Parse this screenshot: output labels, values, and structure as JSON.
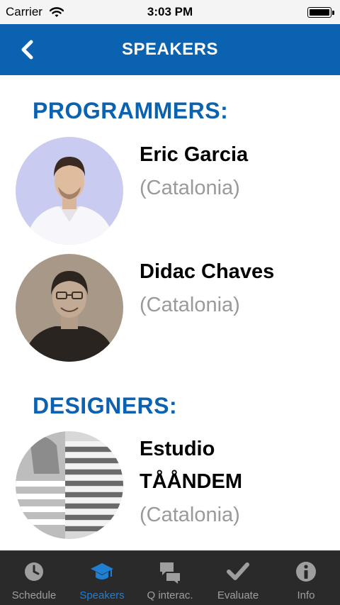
{
  "status_bar": {
    "carrier": "Carrier",
    "time": "3:03 PM"
  },
  "nav": {
    "title": "SPEAKERS",
    "back_icon": "chevron-left-icon"
  },
  "sections": [
    {
      "title": "PROGRAMMERS:",
      "speakers": [
        {
          "name_lines": [
            "Eric Garcia"
          ],
          "region": "(Catalonia)"
        },
        {
          "name_lines": [
            "Didac Chaves"
          ],
          "region": "(Catalonia)"
        }
      ]
    },
    {
      "title": "DESIGNERS:",
      "speakers": [
        {
          "name_lines": [
            "Estudio",
            "TÅÅNDEM"
          ],
          "region": "(Catalonia)"
        }
      ]
    }
  ],
  "tabs": [
    {
      "label": "Schedule",
      "icon": "clock-icon",
      "active": false
    },
    {
      "label": "Speakers",
      "icon": "graduation-cap-icon",
      "active": true
    },
    {
      "label": "Q interac.",
      "icon": "chat-bubbles-icon",
      "active": false
    },
    {
      "label": "Evaluate",
      "icon": "checkmark-icon",
      "active": false
    },
    {
      "label": "Info",
      "icon": "info-icon",
      "active": false
    }
  ],
  "colors": {
    "accent": "#0b62b0",
    "tab_active": "#1f7fd2",
    "tab_inactive": "#9e9e9e",
    "region_text": "#9a9a9a"
  }
}
